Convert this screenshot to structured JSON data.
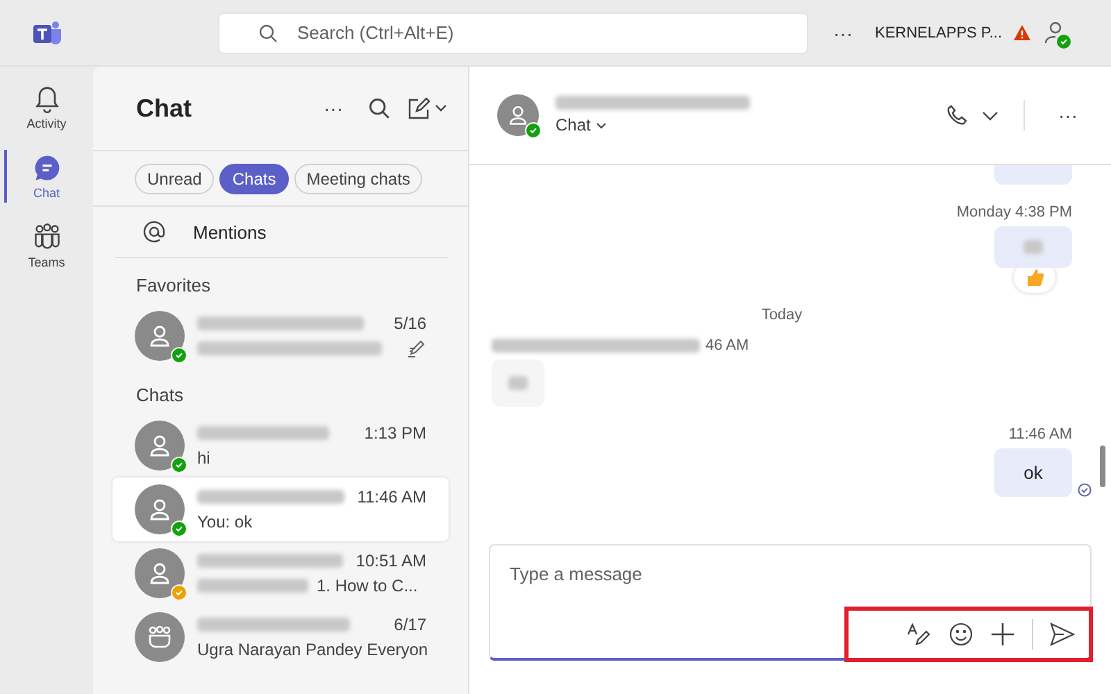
{
  "app_bar": {
    "search": {
      "placeholder": "Search (Ctrl+Alt+E)"
    },
    "more": "···",
    "org": "KERNELAPPS P...",
    "warning": true,
    "color": "#13a10e"
  },
  "rail": [
    {
      "label": "Activity",
      "selected": false
    },
    {
      "label": "Chat",
      "selected": true
    },
    {
      "label": "Teams",
      "selected": false
    }
  ],
  "chat_list": {
    "title": "Chat",
    "more": "···",
    "filters": [
      {
        "label": "Unread",
        "selected": false
      },
      {
        "label": "Chats",
        "selected": true
      },
      {
        "label": "Meeting chats",
        "selected": false
      }
    ],
    "mentions": "Mentions",
    "sections": [
      {
        "title": "Favorites",
        "items": [
          {
            "kind": "person",
            "color": "#13a10e",
            "time": "5/16",
            "preview_blurred": true,
            "draft": true,
            "selected": false
          }
        ]
      },
      {
        "title": "Chats",
        "items": [
          {
            "kind": "person",
            "color": "#13a10e",
            "time": "1:13 PM",
            "preview": "hi",
            "selected": false
          },
          {
            "kind": "person",
            "color": "#13a10e",
            "time": "11:46 AM",
            "preview": "You: ok",
            "selected": true
          },
          {
            "kind": "person",
            "color": "#eaa300",
            "time": "10:51 AM",
            "preview_blurred": true,
            "preview": "1. How to C...",
            "selected": false
          },
          {
            "kind": "group",
            "time": "6/17",
            "preview": "Ugra Narayan Pandey Everyon",
            "selected": false
          }
        ]
      }
    ]
  },
  "conversation": {
    "color": "#13a10e",
    "tab": "Chat",
    "more": "···",
    "messages": [
      {
        "kind": "mine",
        "cut": true
      },
      {
        "kind": "mine",
        "time": "Monday 4:38 PM",
        "reaction": true
      },
      {
        "kind": "day",
        "text": "Today"
      },
      {
        "kind": "theirs",
        "time": "46 AM"
      },
      {
        "kind": "mine",
        "time": "11:46 AM",
        "text": "ok",
        "seen": true
      }
    ],
    "composer": {
      "placeholder": "Type a message",
      "highlighted": true
    }
  }
}
